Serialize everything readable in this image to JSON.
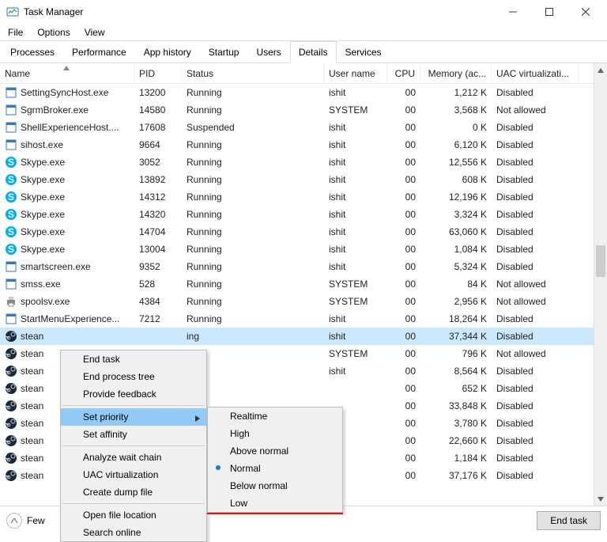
{
  "window": {
    "title": "Task Manager"
  },
  "menu": {
    "file": "File",
    "options": "Options",
    "view": "View"
  },
  "tabs": [
    "Processes",
    "Performance",
    "App history",
    "Startup",
    "Users",
    "Details",
    "Services"
  ],
  "active_tab": 5,
  "columns": {
    "name": "Name",
    "pid": "PID",
    "status": "Status",
    "user": "User name",
    "cpu": "CPU",
    "mem": "Memory (ac...",
    "uac": "UAC virtualizati..."
  },
  "processes": [
    {
      "icon": "generic",
      "name": "SettingSyncHost.exe",
      "pid": "13200",
      "status": "Running",
      "user": "ishit",
      "cpu": "00",
      "mem": "1,212 K",
      "uac": "Disabled",
      "sel": false
    },
    {
      "icon": "generic",
      "name": "SgrmBroker.exe",
      "pid": "14580",
      "status": "Running",
      "user": "SYSTEM",
      "cpu": "00",
      "mem": "3,568 K",
      "uac": "Not allowed",
      "sel": false
    },
    {
      "icon": "generic",
      "name": "ShellExperienceHost....",
      "pid": "17608",
      "status": "Suspended",
      "user": "ishit",
      "cpu": "00",
      "mem": "0 K",
      "uac": "Disabled",
      "sel": false
    },
    {
      "icon": "generic",
      "name": "sihost.exe",
      "pid": "9664",
      "status": "Running",
      "user": "ishit",
      "cpu": "00",
      "mem": "6,120 K",
      "uac": "Disabled",
      "sel": false
    },
    {
      "icon": "skype",
      "name": "Skype.exe",
      "pid": "3052",
      "status": "Running",
      "user": "ishit",
      "cpu": "00",
      "mem": "12,556 K",
      "uac": "Disabled",
      "sel": false
    },
    {
      "icon": "skype",
      "name": "Skype.exe",
      "pid": "13892",
      "status": "Running",
      "user": "ishit",
      "cpu": "00",
      "mem": "608 K",
      "uac": "Disabled",
      "sel": false
    },
    {
      "icon": "skype",
      "name": "Skype.exe",
      "pid": "14312",
      "status": "Running",
      "user": "ishit",
      "cpu": "00",
      "mem": "12,196 K",
      "uac": "Disabled",
      "sel": false
    },
    {
      "icon": "skype",
      "name": "Skype.exe",
      "pid": "14320",
      "status": "Running",
      "user": "ishit",
      "cpu": "00",
      "mem": "3,324 K",
      "uac": "Disabled",
      "sel": false
    },
    {
      "icon": "skype",
      "name": "Skype.exe",
      "pid": "14704",
      "status": "Running",
      "user": "ishit",
      "cpu": "00",
      "mem": "63,060 K",
      "uac": "Disabled",
      "sel": false
    },
    {
      "icon": "skype",
      "name": "Skype.exe",
      "pid": "13004",
      "status": "Running",
      "user": "ishit",
      "cpu": "00",
      "mem": "1,084 K",
      "uac": "Disabled",
      "sel": false
    },
    {
      "icon": "generic",
      "name": "smartscreen.exe",
      "pid": "9352",
      "status": "Running",
      "user": "ishit",
      "cpu": "00",
      "mem": "5,324 K",
      "uac": "Disabled",
      "sel": false
    },
    {
      "icon": "generic",
      "name": "smss.exe",
      "pid": "528",
      "status": "Running",
      "user": "SYSTEM",
      "cpu": "00",
      "mem": "84 K",
      "uac": "Not allowed",
      "sel": false
    },
    {
      "icon": "printer",
      "name": "spoolsv.exe",
      "pid": "4384",
      "status": "Running",
      "user": "SYSTEM",
      "cpu": "00",
      "mem": "2,956 K",
      "uac": "Not allowed",
      "sel": false
    },
    {
      "icon": "generic",
      "name": "StartMenuExperience...",
      "pid": "7212",
      "status": "Running",
      "user": "ishit",
      "cpu": "00",
      "mem": "18,264 K",
      "uac": "Disabled",
      "sel": false
    },
    {
      "icon": "steam",
      "name": "stean",
      "pid": "",
      "status": "ing",
      "user": "ishit",
      "cpu": "00",
      "mem": "37,344 K",
      "uac": "Disabled",
      "sel": true
    },
    {
      "icon": "steam",
      "name": "stean",
      "pid": "",
      "status": "ing",
      "user": "SYSTEM",
      "cpu": "00",
      "mem": "796 K",
      "uac": "Not allowed",
      "sel": false
    },
    {
      "icon": "steam",
      "name": "stean",
      "pid": "",
      "status": "ing",
      "user": "ishit",
      "cpu": "00",
      "mem": "8,564 K",
      "uac": "Disabled",
      "sel": false
    },
    {
      "icon": "steam",
      "name": "stean",
      "pid": "",
      "status": "",
      "user": "",
      "cpu": "00",
      "mem": "652 K",
      "uac": "Disabled",
      "sel": false
    },
    {
      "icon": "steam",
      "name": "stean",
      "pid": "",
      "status": "",
      "user": "",
      "cpu": "00",
      "mem": "33,848 K",
      "uac": "Disabled",
      "sel": false
    },
    {
      "icon": "steam",
      "name": "stean",
      "pid": "",
      "status": "",
      "user": "",
      "cpu": "00",
      "mem": "3,780 K",
      "uac": "Disabled",
      "sel": false
    },
    {
      "icon": "steam",
      "name": "stean",
      "pid": "",
      "status": "",
      "user": "",
      "cpu": "00",
      "mem": "22,660 K",
      "uac": "Disabled",
      "sel": false
    },
    {
      "icon": "steam",
      "name": "stean",
      "pid": "",
      "status": "",
      "user": "",
      "cpu": "00",
      "mem": "1,184 K",
      "uac": "Disabled",
      "sel": false
    },
    {
      "icon": "steam",
      "name": "stean",
      "pid": "",
      "status": "",
      "user": "",
      "cpu": "00",
      "mem": "37,176 K",
      "uac": "Disabled",
      "sel": false
    }
  ],
  "context_menu": {
    "items": [
      "End task",
      "End process tree",
      "Provide feedback",
      "Set priority",
      "Set affinity",
      "Analyze wait chain",
      "UAC virtualization",
      "Create dump file",
      "Open file location",
      "Search online"
    ],
    "hover_idx": 3,
    "sep_after": [
      2,
      4,
      7
    ]
  },
  "sub_menu": {
    "items": [
      "Realtime",
      "High",
      "Above normal",
      "Normal",
      "Below normal",
      "Low"
    ],
    "checked_idx": 3
  },
  "footer": {
    "fewer": "Few",
    "end_task": "End task"
  }
}
